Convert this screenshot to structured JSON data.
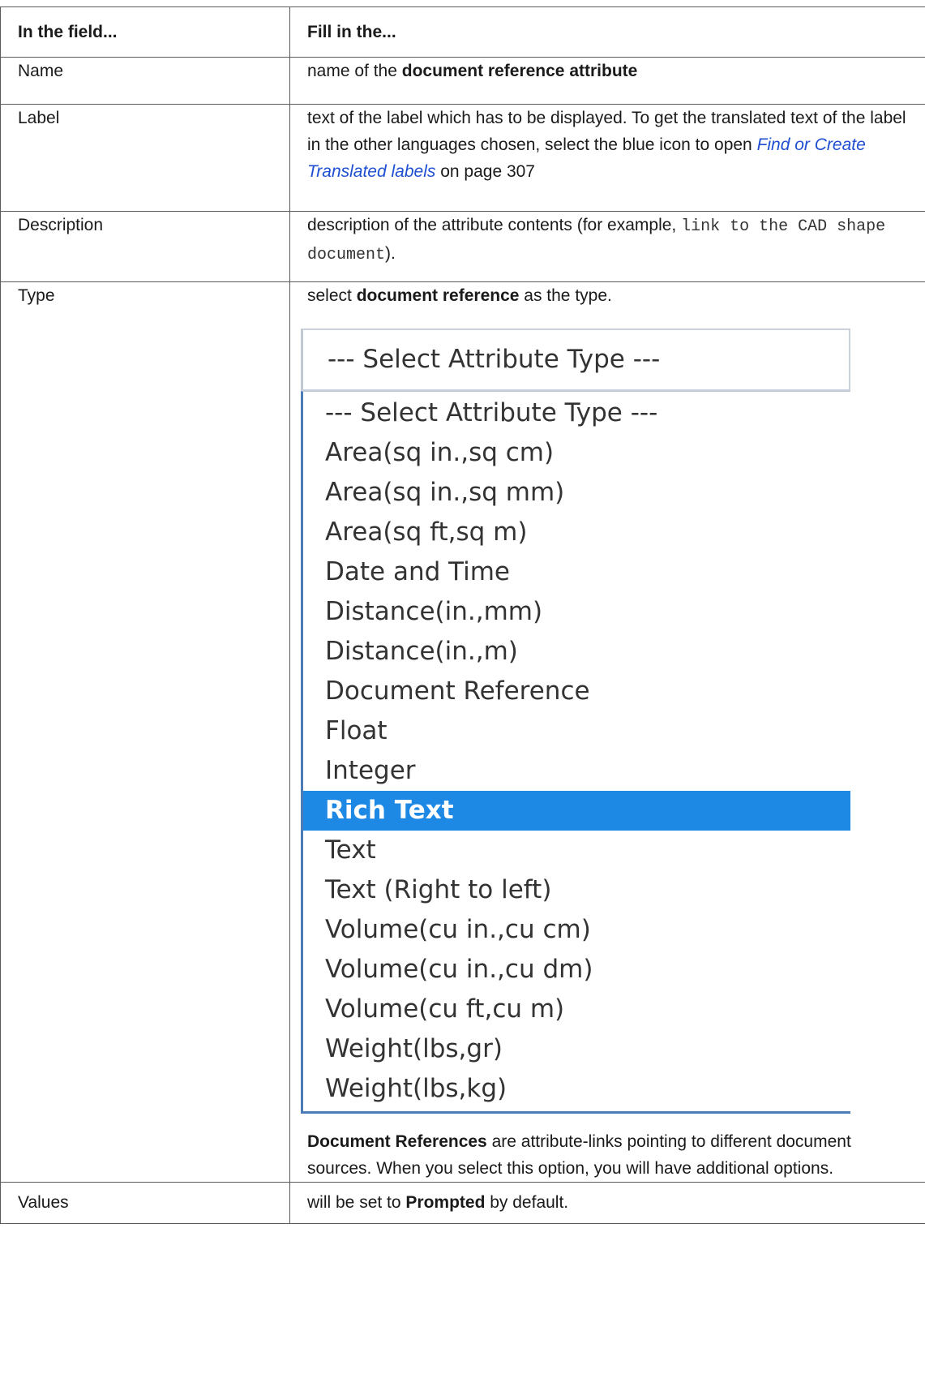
{
  "header": {
    "col_field": "In the field...",
    "col_fill": "Fill in the..."
  },
  "rows": {
    "name": {
      "field": "Name",
      "text_pre": "name of the ",
      "text_bold": "document reference attribute"
    },
    "label": {
      "field": "Label",
      "text_pre": "text of the label which has to be displayed. To get the translated text of the label in the other languages chosen, select the blue icon to open ",
      "link": "Find or Create Translated labels",
      "text_post": " on page 307"
    },
    "description": {
      "field": "Description",
      "text_pre": "description of the attribute contents (for example, ",
      "code": "link to the CAD shape document",
      "text_post": ")."
    },
    "type": {
      "field": "Type",
      "text_pre": "select ",
      "text_bold": "document reference",
      "text_post": " as the type.",
      "select": {
        "current_value": "--- Select Attribute Type ---",
        "options": [
          "--- Select Attribute Type ---",
          "Area(sq in.,sq cm)",
          "Area(sq in.,sq mm)",
          "Area(sq ft,sq m)",
          "Date and Time",
          "Distance(in.,mm)",
          "Distance(in.,m)",
          "Document Reference",
          "Float",
          "Integer",
          "Rich Text",
          "Text",
          "Text (Right to left)",
          "Volume(cu in.,cu cm)",
          "Volume(cu in.,cu dm)",
          "Volume(cu ft,cu m)",
          "Weight(lbs,gr)",
          "Weight(lbs,kg)"
        ],
        "highlighted_option": "Rich Text",
        "highlight_color": "#1e88e5"
      },
      "note_bold": "Document References",
      "note_text": " are attribute-links pointing to different document sources. When you select this option, you will have additional options."
    },
    "values": {
      "field": "Values",
      "text_pre": "will be set to ",
      "text_bold": "Prompted",
      "text_post": " by default."
    }
  },
  "colors": {
    "link": "#1f4fd1",
    "border": "#5a5a5a"
  }
}
